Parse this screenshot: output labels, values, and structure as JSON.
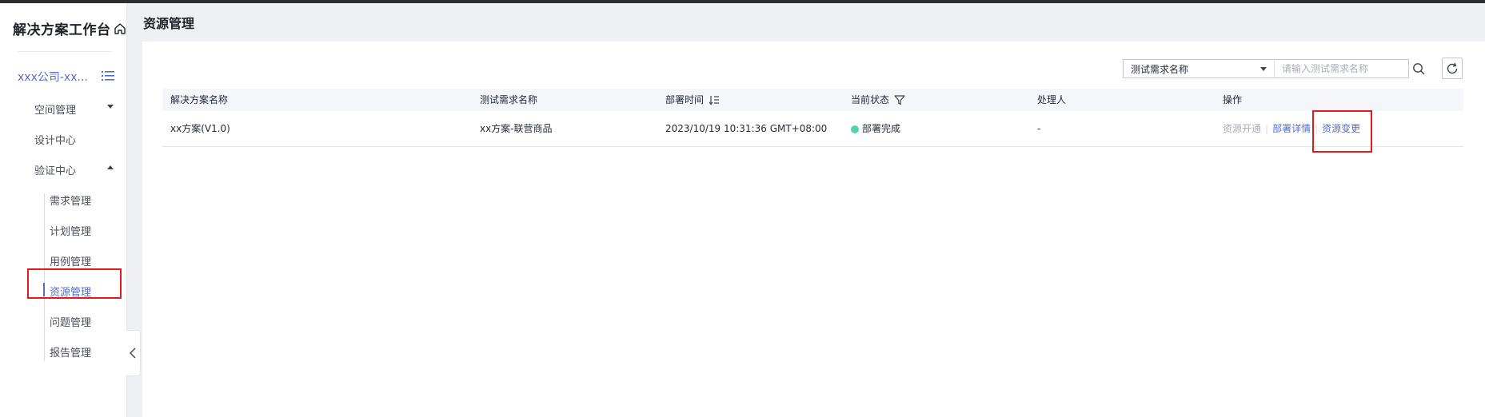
{
  "sidebar": {
    "title": "解决方案工作台",
    "project": "xxx公司-xx...",
    "nav": [
      {
        "label": "空间管理",
        "caret": "down"
      },
      {
        "label": "设计中心"
      },
      {
        "label": "验证中心",
        "caret": "up"
      }
    ],
    "sub": [
      {
        "label": "需求管理"
      },
      {
        "label": "计划管理"
      },
      {
        "label": "用例管理"
      },
      {
        "label": "资源管理",
        "active": true
      },
      {
        "label": "问题管理"
      },
      {
        "label": "报告管理"
      }
    ]
  },
  "header": {
    "title": "资源管理"
  },
  "search": {
    "field": "测试需求名称",
    "placeholder": "请输入测试需求名称"
  },
  "table": {
    "columns": [
      "解决方案名称",
      "测试需求名称",
      "部署时间",
      "当前状态",
      "处理人",
      "操作"
    ],
    "rows": [
      {
        "solution": "xx方案(V1.0)",
        "requirement": "xx方案-联营商品",
        "deploy_time": "2023/10/19 10:31:36 GMT+08:00",
        "status": "部署完成",
        "handler": "-",
        "actions": {
          "open": "资源开通",
          "detail": "部署详情",
          "change": "资源变更"
        }
      }
    ]
  },
  "colors": {
    "accent": "#526ecc",
    "status_ok": "#50d4ab",
    "highlight": "#e5191b"
  }
}
